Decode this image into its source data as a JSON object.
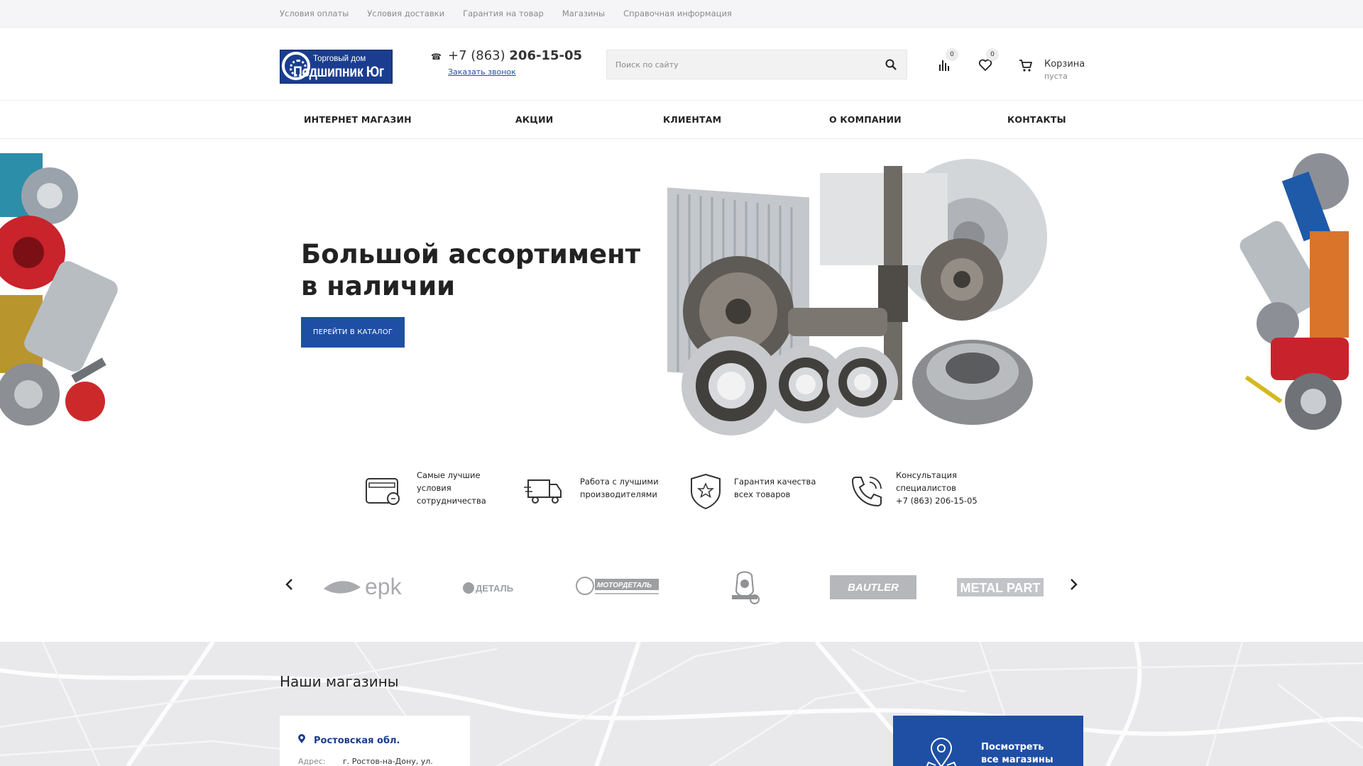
{
  "topbar": {
    "links": [
      "Условия оплаты",
      "Условия доставки",
      "Гарантия на товар",
      "Магазины",
      "Справочная информация"
    ]
  },
  "header": {
    "logo": {
      "line1": "Торговый дом",
      "line2": "Подшипник Юг"
    },
    "phone_prefix": "+7 (863)",
    "phone_number": "206-15-05",
    "callback": "Заказать звонок",
    "search_placeholder": "Поиск по сайту",
    "compare_count": "0",
    "wishlist_count": "0",
    "cart_label": "Корзина",
    "cart_status": "пуста"
  },
  "nav": {
    "items": [
      "ИНТЕРНЕТ МАГАЗИН",
      "АКЦИИ",
      "КЛИЕНТАМ",
      "О КОМПАНИИ",
      "КОНТАКТЫ"
    ]
  },
  "hero": {
    "title": "Большой ассортимент в наличии",
    "button": "ПЕРЕЙТИ В КАТАЛОГ"
  },
  "features": [
    {
      "icon": "wallet-card-icon",
      "lines": [
        "Самые лучшие",
        "условия",
        "сотрудничества"
      ]
    },
    {
      "icon": "delivery-truck-icon",
      "lines": [
        "Работа с лучшими",
        "производителями"
      ]
    },
    {
      "icon": "shield-star-icon",
      "lines": [
        "Гарантия качества",
        "всех товаров"
      ]
    },
    {
      "icon": "phone-call-icon",
      "lines": [
        "Консультация",
        "специалистов",
        "+7 (863) 206-15-05"
      ]
    }
  ],
  "brands": {
    "items": [
      {
        "name": "epk",
        "text": "epk"
      },
      {
        "name": "detal",
        "text": "ДЕТАЛЬ"
      },
      {
        "name": "motordetal",
        "text": "МОТОРДЕТАЛЬ"
      },
      {
        "name": "kostroma-bear",
        "text": ""
      },
      {
        "name": "bautler",
        "text": "BAUTLER"
      },
      {
        "name": "metalpart",
        "text": "METAL PART"
      }
    ]
  },
  "stores": {
    "title": "Наши магазины",
    "region": "Ростовская обл.",
    "address_label": "Адрес:",
    "address_value": "г. Ростов-на-Дону, ул.",
    "all_stores_line1": "Посмотреть",
    "all_stores_line2": "все магазины"
  },
  "colors": {
    "accent": "#1f4fa4",
    "brand_dark": "#1a3d8f",
    "topbar_bg": "#f5f5f7"
  }
}
